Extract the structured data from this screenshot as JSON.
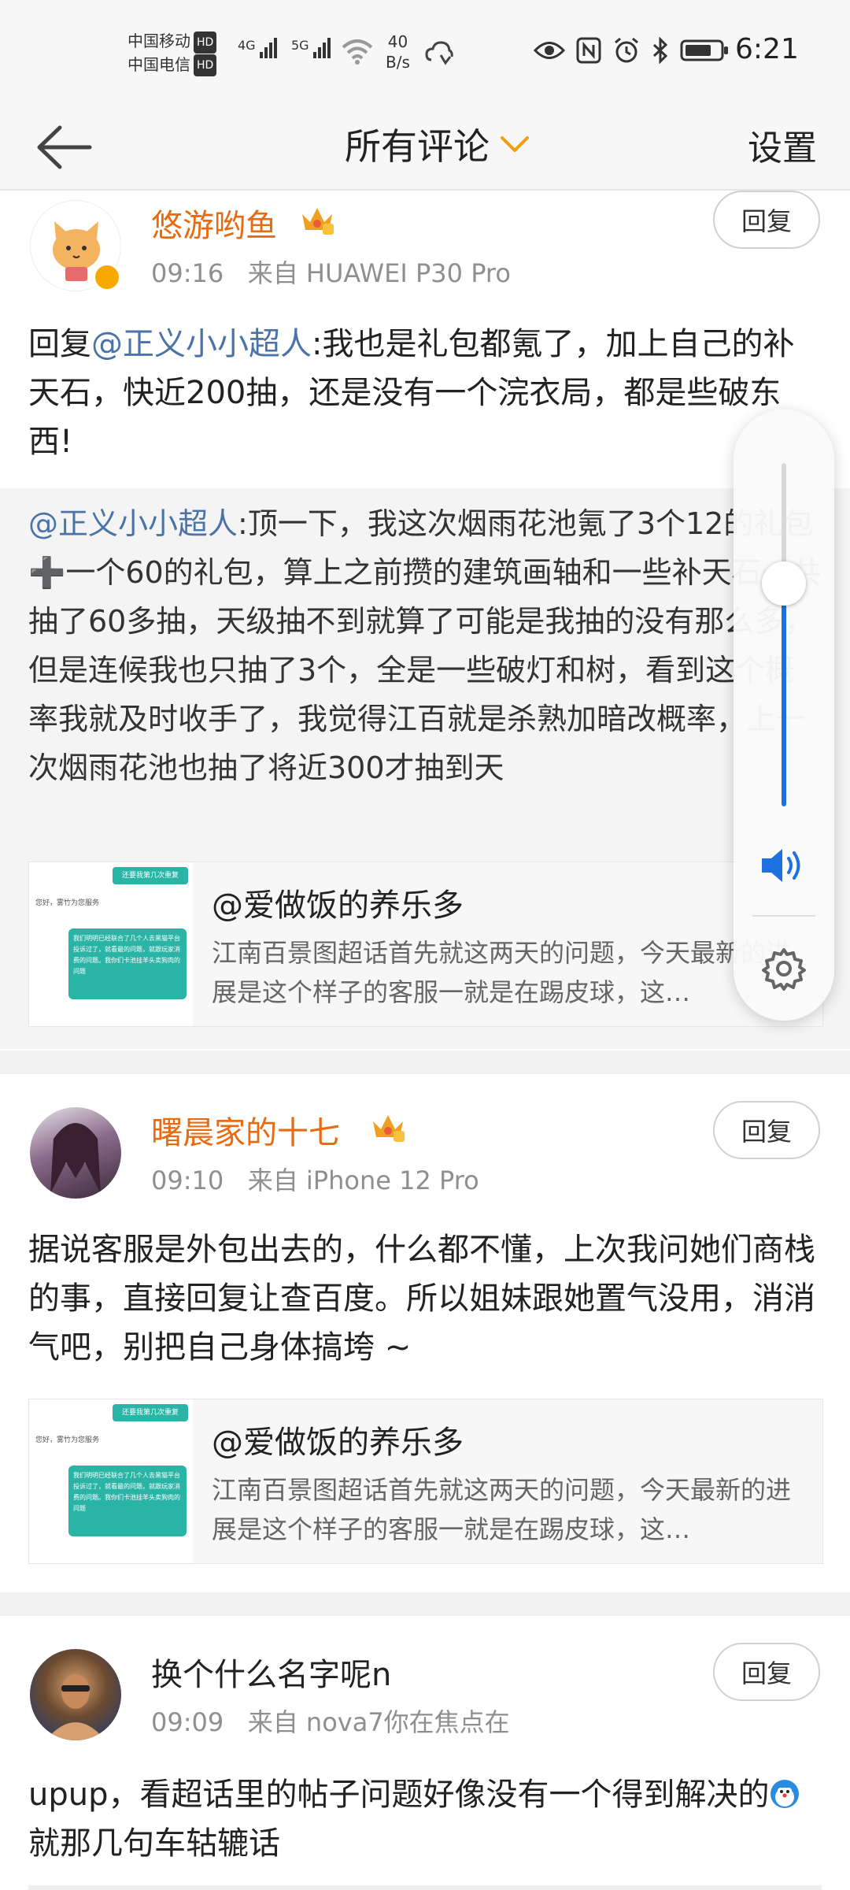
{
  "status": {
    "carrier1": "中国移动",
    "carrier2": "中国电信",
    "hd": "HD",
    "net1": "4G",
    "net2": "5G",
    "speed_value": "40",
    "speed_unit": "B/s",
    "time": "6:21"
  },
  "header": {
    "title": "所有评论",
    "settings": "设置"
  },
  "comments": [
    {
      "username": "悠游哟鱼",
      "time": "09:16",
      "source": "来自 HUAWEI P30 Pro",
      "reply_label": "回复",
      "reply_prefix": "回复",
      "mention": "@正义小小超人",
      "text": ":我也是礼包都氪了，加上自己的补天石，快近200抽，还是没有一个浣衣局，都是些破东西!",
      "quote_mention": "@正义小小超人",
      "quote_text": ":顶一下，我这次烟雨花池氪了3个12的礼包➕一个60的礼包，算上之前攒的建筑画轴和一些补天石一共抽了60多抽，天级抽不到就算了可能是我抽的没有那么多，但是连候我也只抽了3个，全是一些破灯和树，看到这个概率我就及时收手了，我觉得江百就是杀熟加暗改概率，上一次烟雨花池也抽了将近300才抽到天",
      "card_title": "@爱做饭的养乐多",
      "card_desc": "江南百景图超话首先就这两天的问题，今天最新的进展是这个样子的客服一就是在踢皮球，这…"
    },
    {
      "username": "曙晨家的十七",
      "time": "09:10",
      "source": "来自 iPhone 12 Pro",
      "reply_label": "回复",
      "text": "据说客服是外包出去的，什么都不懂，上次我问她们商栈的事，直接回复让查百度。所以姐妹跟她置气没用，消消气吧，别把自己身体搞垮 ~",
      "card_title": "@爱做饭的养乐多",
      "card_desc": "江南百景图超话首先就这两天的问题，今天最新的进展是这个样子的客服一就是在踢皮球，这…"
    },
    {
      "username": "换个什么名字呢n",
      "time": "09:09",
      "source": "来自 nova7你在焦点在",
      "reply_label": "回复",
      "text_a": "upup，看超话里的帖子问题好像没有一个得到解决的",
      "text_b": "就那几句车轱辘话"
    }
  ],
  "thumb": {
    "line1": "还要我第几次重复",
    "line2": "您好，雾竹为您服务",
    "line3": "我们明明已经联合了几个人去黑猫平台投诉过了，就看最的问题，就跟玩家消费的问题。我你们卡池挂羊头卖狗肉的问题"
  },
  "volume": {
    "level": 0.65
  },
  "colors": {
    "vip_name": "#e86b11",
    "mention": "#4a74a8",
    "volume_fill": "#1e6fe0",
    "title_chevron": "#f39c12"
  },
  "icons": {
    "back": "arrow-left-icon",
    "dropdown": "chevron-down-icon",
    "crown": "vip-crown-icon",
    "speaker": "speaker-icon",
    "gear": "gear-icon"
  }
}
